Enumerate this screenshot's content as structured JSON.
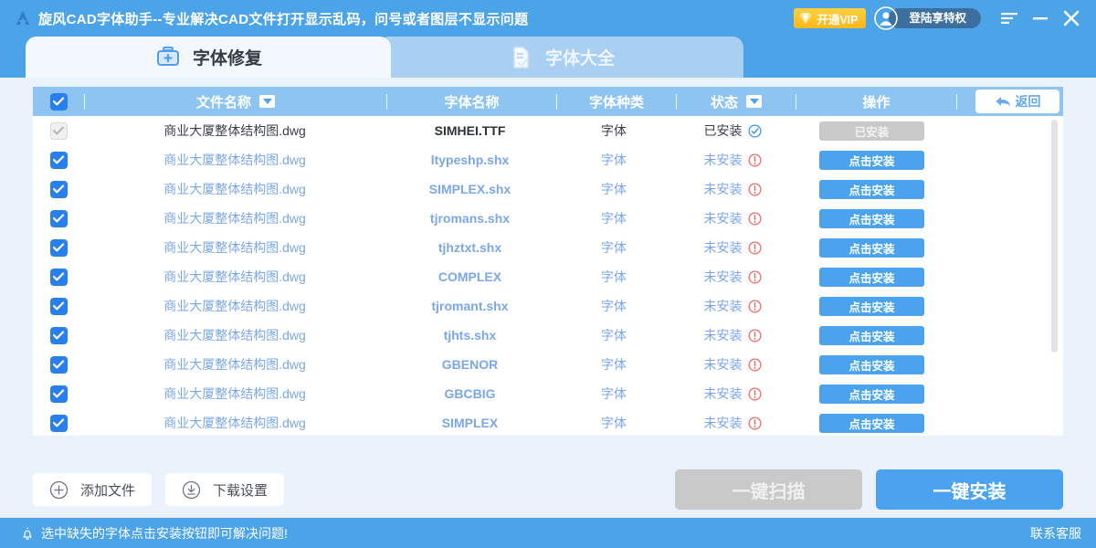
{
  "window": {
    "title": "旋风CAD字体助手--专业解决CAD文件打开显示乱码，问号或者图层不显示问题",
    "logo_icon": "app-logo-icon",
    "vip_label": "开通VIP",
    "vip_icon": "diamond-icon",
    "avatar_icon": "user-avatar-icon",
    "login_label": "登陆享特权",
    "menu_icon": "hamburger-menu-icon",
    "minimize_icon": "minimize-icon",
    "close_icon": "close-icon",
    "header_color": "#4ba3e8",
    "vip_color": "#fdb819"
  },
  "tabs": [
    {
      "label": "字体修复",
      "icon": "toolbox-plus-icon",
      "active": true
    },
    {
      "label": "字体大全",
      "icon": "document-check-icon",
      "active": false
    }
  ],
  "table": {
    "select_all_checked": true,
    "columns": [
      {
        "key": "checkbox",
        "label": "",
        "class": "col-check",
        "caret": false
      },
      {
        "key": "file",
        "label": "文件名称",
        "class": "col-file",
        "caret": true
      },
      {
        "key": "font",
        "label": "字体名称",
        "class": "col-font",
        "caret": false
      },
      {
        "key": "kind",
        "label": "字体种类",
        "class": "col-kind",
        "caret": false
      },
      {
        "key": "state",
        "label": "状态",
        "class": "col-state",
        "caret": true
      },
      {
        "key": "action",
        "label": "操作",
        "class": "col-act",
        "caret": false
      }
    ],
    "back_button": {
      "label": "返回",
      "icon": "back-arrow-icon"
    },
    "rows": [
      {
        "checked": true,
        "disabled": true,
        "file": "商业大厦整体结构图.dwg",
        "font": "SIMHEI.TTF",
        "kind": "字体",
        "state": "已安装",
        "state_icon": "check-circle-icon",
        "action": "已安装",
        "installed": true
      },
      {
        "checked": true,
        "disabled": false,
        "file": "商业大厦整体结构图.dwg",
        "font": "ltypeshp.shx",
        "kind": "字体",
        "state": "未安装",
        "state_icon": "alert-circle-icon",
        "action": "点击安装",
        "installed": false
      },
      {
        "checked": true,
        "disabled": false,
        "file": "商业大厦整体结构图.dwg",
        "font": "SIMPLEX.shx",
        "kind": "字体",
        "state": "未安装",
        "state_icon": "alert-circle-icon",
        "action": "点击安装",
        "installed": false
      },
      {
        "checked": true,
        "disabled": false,
        "file": "商业大厦整体结构图.dwg",
        "font": "tjromans.shx",
        "kind": "字体",
        "state": "未安装",
        "state_icon": "alert-circle-icon",
        "action": "点击安装",
        "installed": false
      },
      {
        "checked": true,
        "disabled": false,
        "file": "商业大厦整体结构图.dwg",
        "font": "tjhztxt.shx",
        "kind": "字体",
        "state": "未安装",
        "state_icon": "alert-circle-icon",
        "action": "点击安装",
        "installed": false
      },
      {
        "checked": true,
        "disabled": false,
        "file": "商业大厦整体结构图.dwg",
        "font": "COMPLEX",
        "kind": "字体",
        "state": "未安装",
        "state_icon": "alert-circle-icon",
        "action": "点击安装",
        "installed": false
      },
      {
        "checked": true,
        "disabled": false,
        "file": "商业大厦整体结构图.dwg",
        "font": "tjromant.shx",
        "kind": "字体",
        "state": "未安装",
        "state_icon": "alert-circle-icon",
        "action": "点击安装",
        "installed": false
      },
      {
        "checked": true,
        "disabled": false,
        "file": "商业大厦整体结构图.dwg",
        "font": "tjhts.shx",
        "kind": "字体",
        "state": "未安装",
        "state_icon": "alert-circle-icon",
        "action": "点击安装",
        "installed": false
      },
      {
        "checked": true,
        "disabled": false,
        "file": "商业大厦整体结构图.dwg",
        "font": "GBENOR",
        "kind": "字体",
        "state": "未安装",
        "state_icon": "alert-circle-icon",
        "action": "点击安装",
        "installed": false
      },
      {
        "checked": true,
        "disabled": false,
        "file": "商业大厦整体结构图.dwg",
        "font": "GBCBIG",
        "kind": "字体",
        "state": "未安装",
        "state_icon": "alert-circle-icon",
        "action": "点击安装",
        "installed": false
      },
      {
        "checked": true,
        "disabled": false,
        "file": "商业大厦整体结构图.dwg",
        "font": "SIMPLEX",
        "kind": "字体",
        "state": "未安装",
        "state_icon": "alert-circle-icon",
        "action": "点击安装",
        "installed": false
      }
    ]
  },
  "actions": {
    "add_file": {
      "label": "添加文件",
      "icon": "plus-circle-icon"
    },
    "download_settings": {
      "label": "下载设置",
      "icon": "download-circle-icon"
    },
    "scan": {
      "label": "一键扫描",
      "enabled": false
    },
    "install": {
      "label": "一键安装",
      "enabled": true
    }
  },
  "statusbar": {
    "icon": "bell-icon",
    "message": "选中缺失的字体点击安装按钮即可解决问题!",
    "support": "联系客服"
  }
}
